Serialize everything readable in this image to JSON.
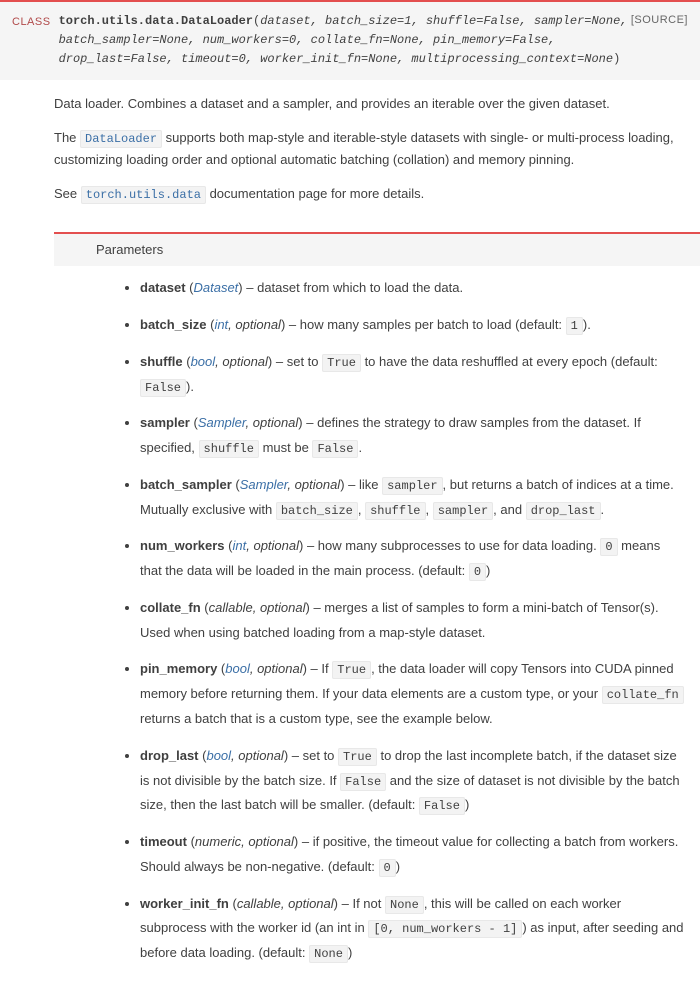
{
  "class_label": "CLASS",
  "source_label": "[SOURCE]",
  "signature": {
    "qualname": "torch.utils.data.DataLoader",
    "params_raw": "dataset, batch_size=1, shuffle=False, sampler=None, batch_sampler=None, num_workers=0, collate_fn=None, pin_memory=False, drop_last=False, timeout=0, worker_init_fn=None, multiprocessing_context=None"
  },
  "description": {
    "p1": "Data loader. Combines a dataset and a sampler, and provides an iterable over the given dataset.",
    "p2a": "The ",
    "p2_code": "DataLoader",
    "p2b": " supports both map-style and iterable-style datasets with single- or multi-process loading, customizing loading order and optional automatic batching (collation) and memory pinning.",
    "p3a": "See ",
    "p3_code": "torch.utils.data",
    "p3b": " documentation page for more details."
  },
  "params_header": "Parameters",
  "params": [
    {
      "name": "dataset",
      "type_html": "<span class='tlink'>Dataset</span>",
      "desc_html": "dataset from which to load the data."
    },
    {
      "name": "batch_size",
      "type_html": "<span class='tlink'>int</span>, optional",
      "desc_html": "how many samples per batch to load (default: <code class='inline'>1</code>)."
    },
    {
      "name": "shuffle",
      "type_html": "<span class='tlink'>bool</span>, optional",
      "desc_html": "set to <code class='inline'>True</code> to have the data reshuffled at every epoch (default: <code class='inline'>False</code>)."
    },
    {
      "name": "sampler",
      "type_html": "<span class='tlink'>Sampler</span>, optional",
      "desc_html": "defines the strategy to draw samples from the dataset. If specified, <code class='inline'>shuffle</code> must be <code class='inline'>False</code>."
    },
    {
      "name": "batch_sampler",
      "type_html": "<span class='tlink'>Sampler</span>, optional",
      "desc_html": "like <code class='inline'>sampler</code>, but returns a batch of indices at a time. Mutually exclusive with <code class='inline'>batch_size</code>, <code class='inline'>shuffle</code>, <code class='inline'>sampler</code>, and <code class='inline'>drop_last</code>."
    },
    {
      "name": "num_workers",
      "type_html": "<span class='tlink'>int</span>, optional",
      "desc_html": "how many subprocesses to use for data loading. <code class='inline'>0</code> means that the data will be loaded in the main process. (default: <code class='inline'>0</code>)"
    },
    {
      "name": "collate_fn",
      "type_html": "callable, optional",
      "desc_html": "merges a list of samples to form a mini-batch of Tensor(s). Used when using batched loading from a map-style dataset."
    },
    {
      "name": "pin_memory",
      "type_html": "<span class='tlink'>bool</span>, optional",
      "desc_html": "If <code class='inline'>True</code>, the data loader will copy Tensors into CUDA pinned memory before returning them. If your data elements are a custom type, or your <code class='inline'>collate_fn</code> returns a batch that is a custom type, see the example below."
    },
    {
      "name": "drop_last",
      "type_html": "<span class='tlink'>bool</span>, optional",
      "desc_html": "set to <code class='inline'>True</code> to drop the last incomplete batch, if the dataset size is not divisible by the batch size. If <code class='inline'>False</code> and the size of dataset is not divisible by the batch size, then the last batch will be smaller. (default: <code class='inline'>False</code>)"
    },
    {
      "name": "timeout",
      "type_html": "numeric, optional",
      "desc_html": "if positive, the timeout value for collecting a batch from workers. Should always be non-negative. (default: <code class='inline'>0</code>)"
    },
    {
      "name": "worker_init_fn",
      "type_html": "callable, optional",
      "desc_html": "If not <code class='inline'>None</code>, this will be called on each worker subprocess with the worker id (an int in <code class='inline'>[0, num_workers - 1]</code>) as input, after seeding and before data loading. (default: <code class='inline'>None</code>)"
    }
  ]
}
